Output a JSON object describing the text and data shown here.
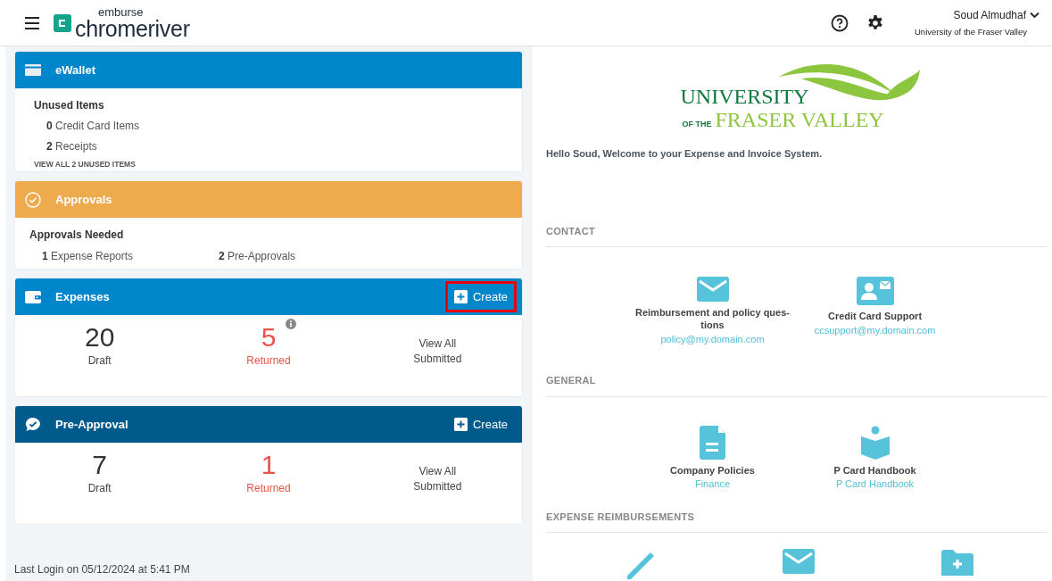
{
  "header": {
    "brand_small": "emburse",
    "brand": "chromeriver",
    "user_name": "Soud Almudhaf",
    "user_org": "University of the Fraser Valley"
  },
  "ewallet": {
    "title": "eWallet",
    "heading": "Unused Items",
    "items": [
      {
        "count": "0",
        "label": "Credit Card Items"
      },
      {
        "count": "2",
        "label": "Receipts"
      }
    ],
    "link": "VIEW ALL 2 UNUSED ITEMS"
  },
  "approvals": {
    "title": "Approvals",
    "heading": "Approvals Needed",
    "items": [
      {
        "count": "1",
        "label": "Expense Reports"
      },
      {
        "count": "2",
        "label": "Pre-Approvals"
      }
    ]
  },
  "panels": [
    {
      "kind": "expenses",
      "title": "Expenses",
      "create": "Create",
      "highlighted": true,
      "draft_count": "20",
      "draft_label": "Draft",
      "returned_count": "5",
      "returned_label": "Returned",
      "info": true,
      "view_all": "View All Submitted"
    },
    {
      "kind": "preapproval",
      "title": "Pre-Approval",
      "create": "Create",
      "highlighted": false,
      "draft_count": "7",
      "draft_label": "Draft",
      "returned_count": "1",
      "returned_label": "Returned",
      "info": false,
      "view_all": "View All Submitted"
    }
  ],
  "last_login": "Last Login on 05/12/2024 at 5:41 PM",
  "logo": {
    "line1": "UNIVERSITY",
    "line2_small": "OF THE",
    "line2": "FRASER VALLEY"
  },
  "welcome": "Hello Soud, Welcome to your Expense and Invoice System.",
  "sections": [
    {
      "title": "CONTACT",
      "items": [
        {
          "kind": "envelope",
          "label": "Reimbursement and policy ques-tions",
          "link": "policy@my.domain.com"
        },
        {
          "kind": "contact-card",
          "label": "Credit Card Support",
          "link": "ccsupport@my.domain.com"
        }
      ]
    },
    {
      "title": "GENERAL",
      "items": [
        {
          "kind": "document",
          "label": "Company Policies",
          "link": "Finance"
        },
        {
          "kind": "reader",
          "label": "P Card Handbook",
          "link": "P Card Handbook"
        }
      ]
    },
    {
      "title": "EXPENSE REIMBURSEMENTS",
      "items": [
        {
          "kind": "pencil"
        },
        {
          "kind": "envelope"
        },
        {
          "kind": "folder"
        }
      ]
    }
  ]
}
